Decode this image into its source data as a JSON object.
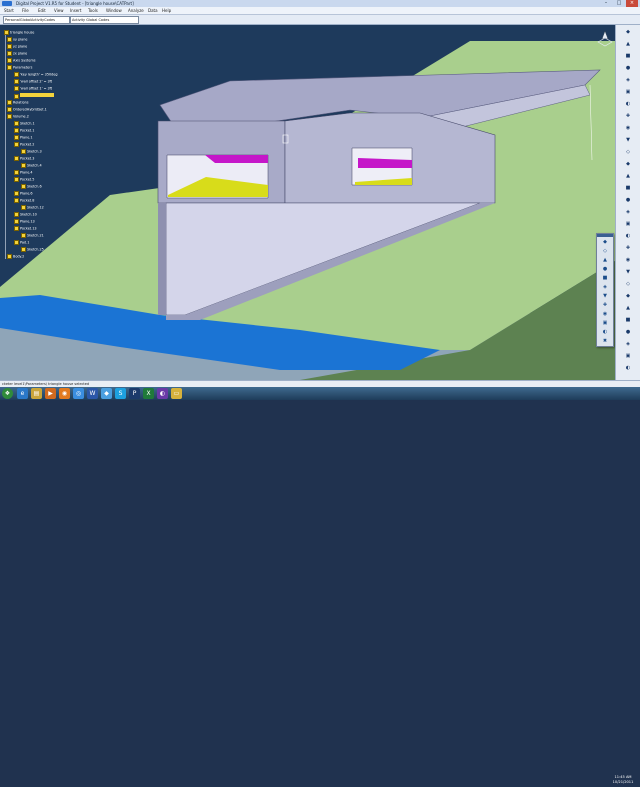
{
  "window": {
    "title": "Digital Project V1.R5 for Student - [triangle house\\CATPart]",
    "min_glyph": "–",
    "max_glyph": "□",
    "close_glyph": "×"
  },
  "menu": [
    "Start",
    "File",
    "Edit",
    "View",
    "Insert",
    "Tools",
    "Window",
    "Analyze",
    "Data",
    "Help"
  ],
  "toolbar": {
    "combo1": "PersonalGlobalActivityCodes",
    "combo2": "Activity Global Codes"
  },
  "tree": {
    "items": [
      {
        "label": "triangle house",
        "x": 0
      },
      {
        "label": "xy plane",
        "x": 2
      },
      {
        "label": "yz plane",
        "x": 2
      },
      {
        "label": "zx plane",
        "x": 2
      },
      {
        "label": "Axis Systems",
        "x": 2
      },
      {
        "label": "Parameters",
        "x": 2
      },
      {
        "label": "'key length' = 350deg",
        "x": 5
      },
      {
        "label": "'wall offset 2' = 3ft",
        "x": 5
      },
      {
        "label": "'wall offset 1' = 3ft",
        "x": 5
      },
      {
        "label": "",
        "x": 5,
        "selected": true
      },
      {
        "label": "Relations",
        "x": 2
      },
      {
        "label": "OrderedHybridSet.1",
        "x": 2
      },
      {
        "label": "Volume.2",
        "x": 2
      },
      {
        "label": "Sketch.1",
        "x": 5
      },
      {
        "label": "Pocket.1",
        "x": 5
      },
      {
        "label": "Plane.1",
        "x": 5
      },
      {
        "label": "Pocket.2",
        "x": 5
      },
      {
        "label": "Sketch.3",
        "x": 8
      },
      {
        "label": "Pocket.3",
        "x": 5
      },
      {
        "label": "Sketch.4",
        "x": 8
      },
      {
        "label": "Plane.4",
        "x": 5
      },
      {
        "label": "Pocket.5",
        "x": 5
      },
      {
        "label": "Sketch.6",
        "x": 8
      },
      {
        "label": "Plane.6",
        "x": 5
      },
      {
        "label": "Pocket.8",
        "x": 5
      },
      {
        "label": "Sketch.12",
        "x": 8
      },
      {
        "label": "Sketch.10",
        "x": 5
      },
      {
        "label": "Plane.13",
        "x": 5
      },
      {
        "label": "Pocket.13",
        "x": 5
      },
      {
        "label": "Sketch.21",
        "x": 8
      },
      {
        "label": "Pad.1",
        "x": 5
      },
      {
        "label": "Sketch.25",
        "x": 8
      },
      {
        "label": "Body.2",
        "x": 2
      }
    ]
  },
  "status": {
    "text": "cketer level1\\Parameters\\ triangle house selected"
  },
  "clock": {
    "time": "11:45 AM",
    "date": "10/21/2011"
  },
  "right_toolbar_icons": [
    "sketch-icon",
    "pad-icon",
    "pocket-icon",
    "shaft-icon",
    "groove-icon",
    "hole-icon",
    "rib-icon",
    "slot-icon",
    "stiffener-icon",
    "loft-icon",
    "fillet-icon",
    "chamfer-icon",
    "draft-icon",
    "shell-icon",
    "thickness-icon",
    "thread-icon",
    "split-icon",
    "thick-surface-icon",
    "close-surface-icon",
    "sew-icon",
    "translate-icon",
    "rotate-icon",
    "symmetry-icon",
    "mirror-icon",
    "pattern-icon",
    "scale-icon",
    "boolean-icon",
    "measure-icon",
    "analysis-icon",
    "update-icon",
    "constraint-icon",
    "sketch2-icon",
    "plane-icon",
    "point-icon",
    "line-icon",
    "axis-icon",
    "curve-icon",
    "spline-icon",
    "helix-icon",
    "spiral-icon",
    "extrude-icon",
    "revolve-icon",
    "sweep-icon",
    "fill-icon",
    "offset-icon",
    "blend-icon",
    "join-icon",
    "healing-icon"
  ],
  "taskbar_icons": [
    "start-orb-icon",
    "ie-icon",
    "explorer-icon",
    "media-icon",
    "firefox-icon",
    "chrome-icon",
    "word-icon",
    "catia-icon",
    "skype-icon",
    "photoshop-icon",
    "excel-icon",
    "project-icon",
    "folder-icon"
  ],
  "colors": {
    "viewport_bg": "#1e3a5c",
    "ground_green": "#a9cf8d",
    "dark_green": "#5d8251",
    "water_blue": "#1b74d4",
    "building_grey": "#a6a8c7",
    "magenta": "#c516c9",
    "yellow": "#d8dc1a",
    "tree_selected": "#f3d33c"
  }
}
